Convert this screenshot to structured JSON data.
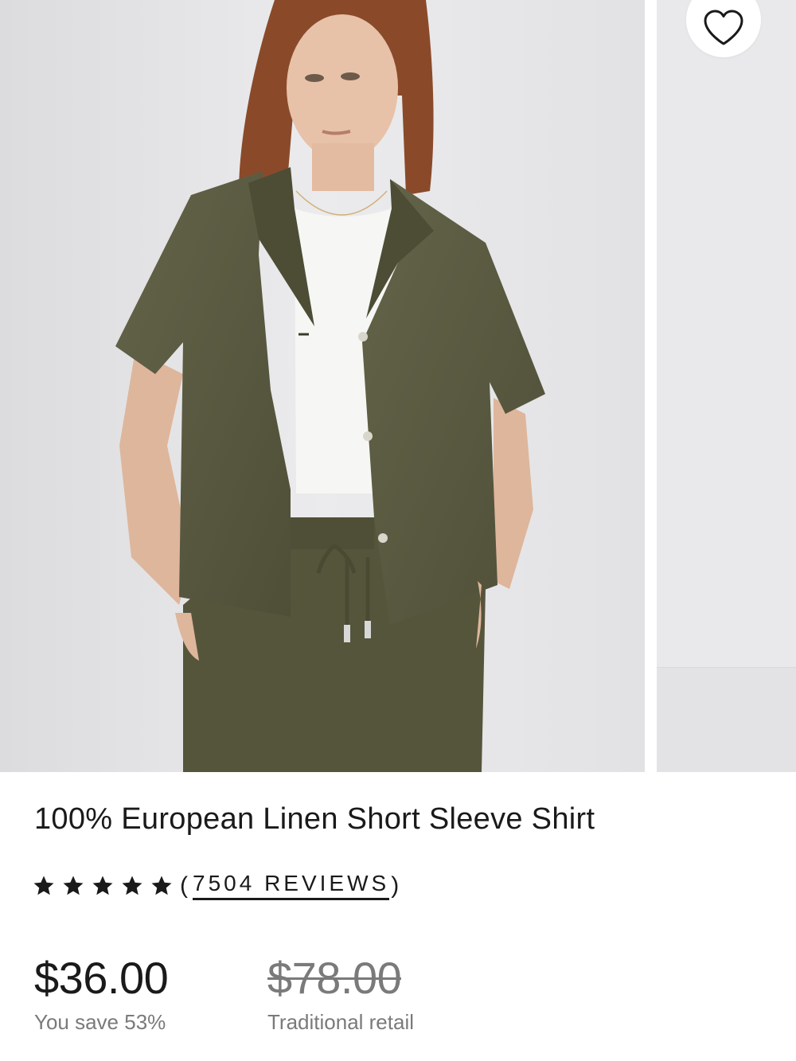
{
  "product": {
    "title": "100% European Linen Short Sleeve Shirt",
    "rating": {
      "stars_filled": 5,
      "stars_total": 5,
      "open_paren": "(",
      "reviews_label": "7504 REVIEWS",
      "close_paren": ")"
    },
    "price": {
      "current": "$36.00",
      "savings": "You save 53%",
      "original": "$78.00",
      "original_label": "Traditional retail"
    }
  },
  "gallery": {
    "main_image": "product-photo",
    "next_image": "product-photo-next",
    "favorite_icon": "heart-outline-icon"
  },
  "colors": {
    "shirt": "#5a5a41",
    "background": "#e6e6e8",
    "text": "#1a1a1a",
    "muted": "#7a7a7a"
  }
}
